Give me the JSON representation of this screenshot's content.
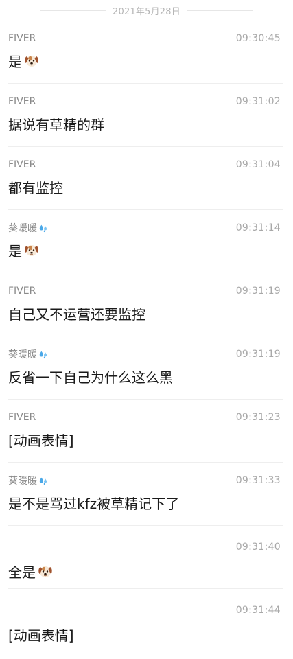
{
  "date_divider": "2021年5月28日",
  "messages": [
    {
      "sender": "FIVER",
      "sender_emoji": "",
      "time": "09:30:45",
      "text": "是",
      "text_emoji": "dog-face"
    },
    {
      "sender": "FIVER",
      "sender_emoji": "",
      "time": "09:31:02",
      "text": "据说有草精的群",
      "text_emoji": ""
    },
    {
      "sender": "FIVER",
      "sender_emoji": "",
      "time": "09:31:04",
      "text": "都有监控",
      "text_emoji": ""
    },
    {
      "sender": "葵暖暖",
      "sender_emoji": "sweat-droplets",
      "time": "09:31:14",
      "text": "是",
      "text_emoji": "dog-face"
    },
    {
      "sender": "FIVER",
      "sender_emoji": "",
      "time": "09:31:19",
      "text": "自己又不运营还要监控",
      "text_emoji": ""
    },
    {
      "sender": "葵暖暖",
      "sender_emoji": "sweat-droplets",
      "time": "09:31:19",
      "text": "反省一下自己为什么这么黑",
      "text_emoji": ""
    },
    {
      "sender": "FIVER",
      "sender_emoji": "",
      "time": "09:31:23",
      "text": "[动画表情]",
      "text_emoji": ""
    },
    {
      "sender": "葵暖暖",
      "sender_emoji": "sweat-droplets",
      "time": "09:31:33",
      "text": "是不是骂过kfz被草精记下了",
      "text_emoji": ""
    },
    {
      "sender": "",
      "sender_emoji": "",
      "time": "09:31:40",
      "text": "全是",
      "text_emoji": "dog-face"
    },
    {
      "sender": "",
      "sender_emoji": "",
      "time": "09:31:44",
      "text": "[动画表情]",
      "text_emoji": ""
    }
  ]
}
